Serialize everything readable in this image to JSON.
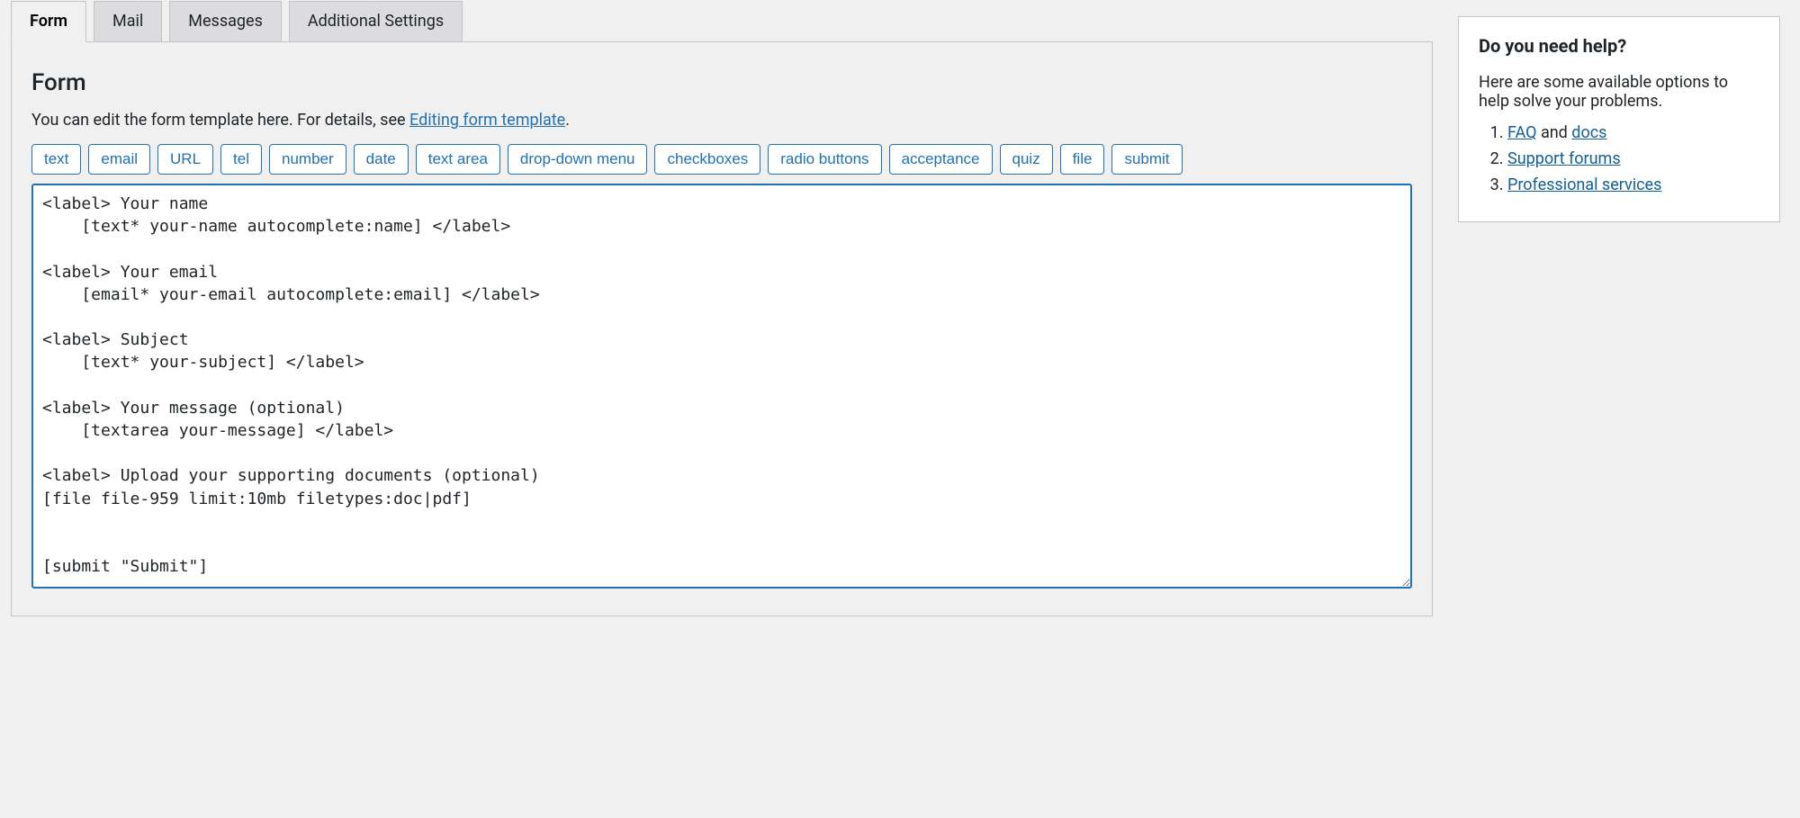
{
  "tabs": {
    "form": "Form",
    "mail": "Mail",
    "messages": "Messages",
    "additional": "Additional Settings"
  },
  "section": {
    "title": "Form",
    "desc_prefix": "You can edit the form template here. For details, see ",
    "desc_link": "Editing form template",
    "desc_suffix": "."
  },
  "tag_buttons": [
    "text",
    "email",
    "URL",
    "tel",
    "number",
    "date",
    "text area",
    "drop-down menu",
    "checkboxes",
    "radio buttons",
    "acceptance",
    "quiz",
    "file",
    "submit"
  ],
  "template": "<label> Your name\n    [text* your-name autocomplete:name] </label>\n\n<label> Your email\n    [email* your-email autocomplete:email] </label>\n\n<label> Subject\n    [text* your-subject] </label>\n\n<label> Your message (optional)\n    [textarea your-message] </label>\n\n<label> Upload your supporting documents (optional)\n[file file-959 limit:10mb filetypes:doc|pdf]\n\n\n[submit \"Submit\"]",
  "help": {
    "title": "Do you need help?",
    "intro": "Here are some available options to help solve your problems.",
    "items": [
      {
        "prefix": "",
        "link": "FAQ",
        "middle": " and ",
        "link2": "docs",
        "suffix": ""
      },
      {
        "prefix": "",
        "link": "Support forums",
        "middle": "",
        "link2": "",
        "suffix": ""
      },
      {
        "prefix": "",
        "link": "Professional services",
        "middle": "",
        "link2": "",
        "suffix": ""
      }
    ]
  }
}
